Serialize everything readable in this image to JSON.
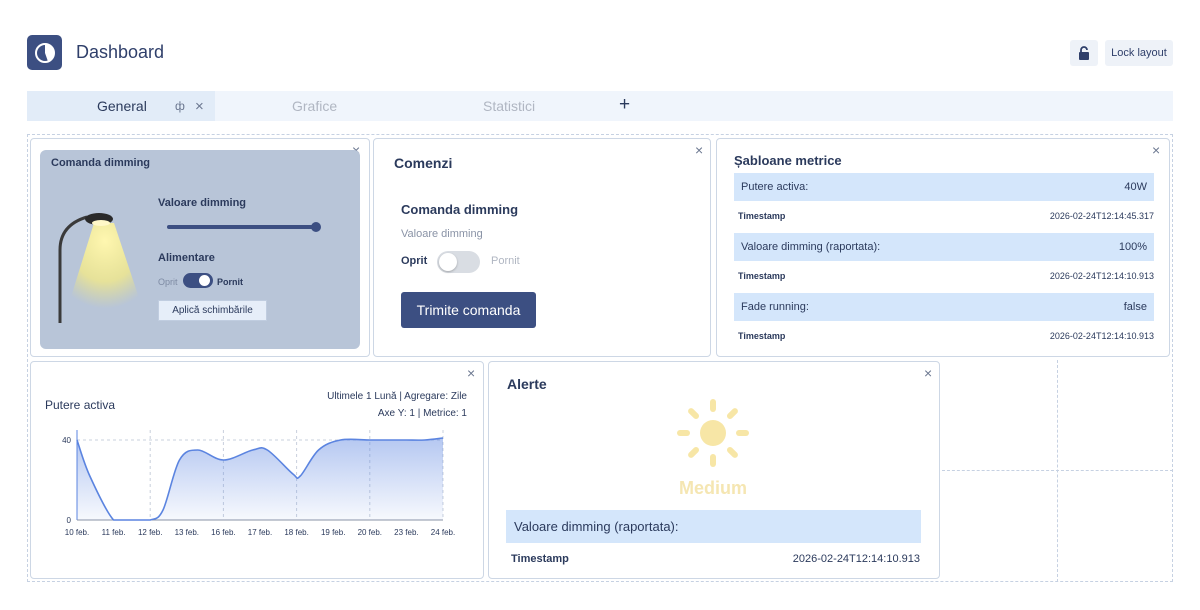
{
  "header": {
    "title": "Dashboard",
    "lock_layout_label": "Lock layout",
    "logo_icon": "pie-chart-icon",
    "lock_icon": "unlock-icon"
  },
  "tabs": [
    {
      "label": "General",
      "active": true,
      "pin_icon": "pin-icon",
      "close_icon": "close-icon"
    },
    {
      "label": "Grafice",
      "active": false
    },
    {
      "label": "Statistici",
      "active": false
    }
  ],
  "tab_add": "+",
  "close_glyph": "×",
  "dimming_card": {
    "title": "Comanda dimming",
    "slider_label": "Valoare dimming",
    "slider_value": 1.0,
    "power_label": "Alimentare",
    "off_label": "Oprit",
    "on_label": "Pornit",
    "toggle_on": true,
    "apply_label": "Aplică schimbările",
    "lamp_icon": "street-lamp-icon"
  },
  "commands_card": {
    "title": "Comenzi",
    "subtitle": "Comanda dimming",
    "field_label": "Valoare dimming",
    "off_label": "Oprit",
    "on_label": "Pornit",
    "toggle_on": false,
    "send_label": "Trimite comanda"
  },
  "metrics_card": {
    "title": "Șabloane metrice",
    "rows": [
      {
        "key": "Putere activa:",
        "value": "40W",
        "ts_label": "Timestamp",
        "ts": "2026-02-24T12:14:45.317"
      },
      {
        "key": "Valoare dimming (raportata):",
        "value": "100%",
        "ts_label": "Timestamp",
        "ts": "2026-02-24T12:14:10.913"
      },
      {
        "key": "Fade running:",
        "value": "false",
        "ts_label": "Timestamp",
        "ts": "2026-02-24T12:14:10.913"
      }
    ]
  },
  "chart_card": {
    "title": "Putere activa",
    "meta_line1": "Ultimele 1 Lună | Agregare: Zile",
    "meta_line2": "Axe Y: 1 | Metrice: 1"
  },
  "chart_data": {
    "type": "area",
    "title": "Putere activa",
    "categories": [
      "10 feb.",
      "11 feb.",
      "12 feb.",
      "13 feb.",
      "16 feb.",
      "17 feb.",
      "18 feb.",
      "19 feb.",
      "20 feb.",
      "23 feb.",
      "24 feb."
    ],
    "x_ticks_at": [
      0,
      1,
      2,
      3,
      4,
      5,
      6,
      7,
      8,
      9,
      10
    ],
    "x": [
      0,
      0.35,
      1,
      1.5,
      2,
      2.35,
      2.8,
      3.3,
      4,
      4.8,
      5.2,
      5.9,
      6.1,
      6.6,
      7.2,
      8,
      8.5,
      9,
      9.5,
      10
    ],
    "values": [
      40,
      22,
      0,
      0,
      0,
      5,
      30,
      35,
      30,
      35,
      35,
      23,
      22,
      35,
      40,
      40,
      40,
      40,
      40,
      41
    ],
    "y_ticks": [
      0,
      40
    ],
    "ylim": [
      0,
      45
    ],
    "grid": true,
    "color": "#5b84e0"
  },
  "alerts_card": {
    "title": "Alerte",
    "severity": "Medium",
    "severity_icon": "sun-icon",
    "severity_color": "#f5e6b2",
    "row_label": "Valoare dimming (raportata):",
    "ts_label": "Timestamp",
    "ts": "2026-02-24T12:14:10.913"
  }
}
